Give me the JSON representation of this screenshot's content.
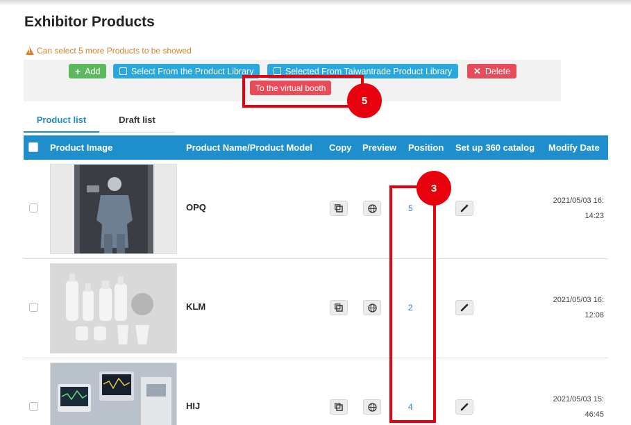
{
  "page": {
    "title": "Exhibitor Products",
    "notice": "Can select 5 more Products to be showed"
  },
  "toolbar": {
    "add_label": "Add",
    "library_label": "Select From the Product Library",
    "taiwantrade_label": "Selected From Taiwantrade Product Library",
    "delete_label": "Delete",
    "virtual_booth_label": "To the virtual booth"
  },
  "tabs": [
    {
      "label": "Product list",
      "active": true
    },
    {
      "label": "Draft list",
      "active": false
    }
  ],
  "table": {
    "headers": {
      "image": "Product Image",
      "name": "Product Name/Product Model",
      "copy": "Copy",
      "preview": "Preview",
      "position": "Position",
      "catalog": "Set up 360 catalog",
      "date": "Modify Date"
    },
    "rows": [
      {
        "name": "OPQ",
        "position": "5",
        "date_line1": "2021/05/03 16:",
        "date_line2": "14:23",
        "image": "mannequin-scrubs-photo"
      },
      {
        "name": "KLM",
        "position": "2",
        "date_line1": "2021/05/03 16:",
        "date_line2": "12:08",
        "image": "cosmetic-bottles-photo"
      },
      {
        "name": "HIJ",
        "position": "4",
        "date_line1": "2021/05/03 15:",
        "date_line2": "46:45",
        "image": "medical-monitors-photo"
      }
    ]
  },
  "annotations": {
    "callout_5": "5",
    "callout_3": "3"
  },
  "colors": {
    "primary": "#1e8fcc",
    "success": "#5cb85c",
    "danger": "#e74c5b",
    "info": "#29a7df",
    "warning": "#d9822b",
    "annotation": "#e8000c"
  }
}
